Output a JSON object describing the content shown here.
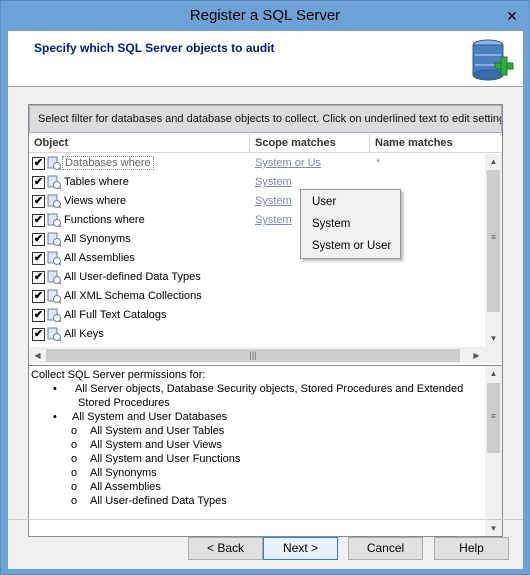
{
  "window": {
    "title": "Register a SQL Server",
    "close_glyph": "✕"
  },
  "header": {
    "text": "Specify which SQL Server objects to audit",
    "icon": "database-add-icon"
  },
  "filter_bar": {
    "text": "Select filter for databases and database objects to collect. Click on underlined text to edit settings."
  },
  "grid": {
    "columns": [
      "Object",
      "Scope matches",
      "Name matches"
    ],
    "rows": [
      {
        "checked": "✔",
        "label": "Databases where",
        "scope": "System or Us",
        "name": "*"
      },
      {
        "checked": "✔",
        "label": "Tables where",
        "scope": "System",
        "name": ""
      },
      {
        "checked": "✔",
        "label": "Views where",
        "scope": "System",
        "name": ""
      },
      {
        "checked": "✔",
        "label": "Functions where",
        "scope": "System",
        "name": ""
      },
      {
        "checked": "✔",
        "label": "All Synonyms",
        "scope": "",
        "name": ""
      },
      {
        "checked": "✔",
        "label": "All Assemblies",
        "scope": "",
        "name": ""
      },
      {
        "checked": "✔",
        "label": "All User-defined Data Types",
        "scope": "",
        "name": ""
      },
      {
        "checked": "✔",
        "label": "All XML Schema Collections",
        "scope": "",
        "name": ""
      },
      {
        "checked": "✔",
        "label": "All Full Text Catalogs",
        "scope": "",
        "name": ""
      },
      {
        "checked": "✔",
        "label": "All Keys",
        "scope": "",
        "name": ""
      }
    ]
  },
  "dropdown": {
    "options": [
      "User",
      "System",
      "System or User"
    ]
  },
  "permissions": {
    "intro": "Collect SQL Server permissions for:",
    "items": [
      {
        "bullet": "•",
        "text": "All Server objects, Database Security objects, Stored Procedures and Extended"
      },
      {
        "bullet": "",
        "text": "Stored Procedures"
      },
      {
        "bullet": "•",
        "text": "All System and User Databases"
      },
      {
        "bullet": "o",
        "text": "All System and User Tables"
      },
      {
        "bullet": "o",
        "text": "All System and User Views"
      },
      {
        "bullet": "o",
        "text": "All System and User Functions"
      },
      {
        "bullet": "o",
        "text": "All Synonyms"
      },
      {
        "bullet": "o",
        "text": "All Assemblies"
      },
      {
        "bullet": "o",
        "text": "All User-defined Data Types"
      }
    ]
  },
  "buttons": {
    "back": "< Back",
    "next": "Next >",
    "cancel": "Cancel",
    "help": "Help"
  }
}
